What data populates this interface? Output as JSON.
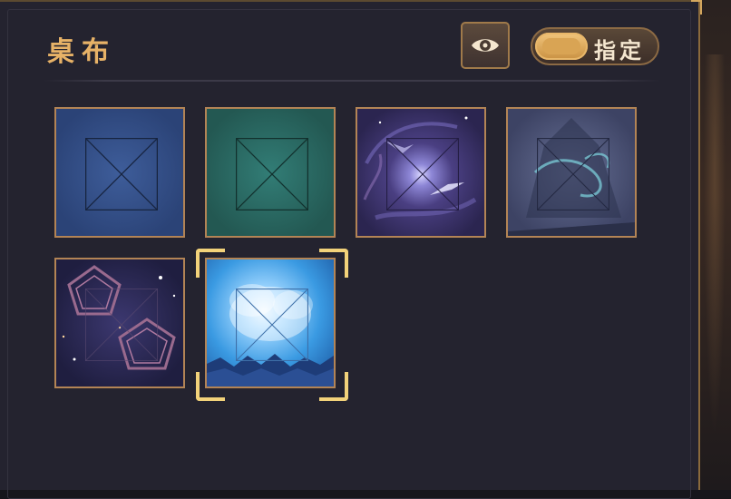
{
  "panel": {
    "title": "桌布",
    "toggle": {
      "label": "指定",
      "on": true
    },
    "eye_button": {
      "icon": "eye-icon"
    }
  },
  "tablecloths": [
    {
      "name": "blue",
      "color": "#2f4a84",
      "selected": false
    },
    {
      "name": "green",
      "color": "#2a6962",
      "selected": false
    },
    {
      "name": "purple-nebula",
      "color": "#3b3268",
      "selected": false
    },
    {
      "name": "misty-gray",
      "color": "#4b5274",
      "selected": false
    },
    {
      "name": "starry-lace",
      "color": "#2a2850",
      "selected": false
    },
    {
      "name": "sky-blue",
      "color": "#3a9ae2",
      "selected": true
    }
  ],
  "colors": {
    "accent": "#e7b267",
    "selection": "#f2d27a",
    "border": "#b38455",
    "panel": "#24232f"
  }
}
